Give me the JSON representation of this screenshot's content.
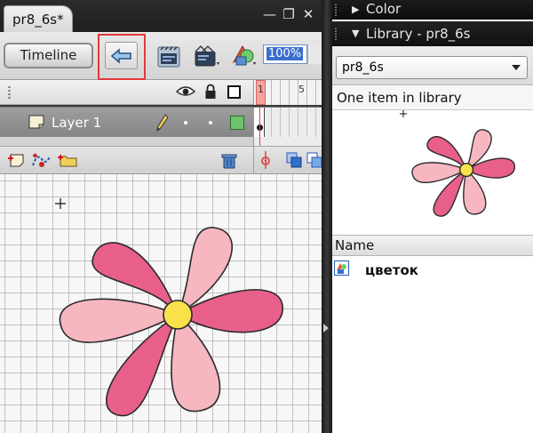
{
  "document": {
    "tab_label": "pr8_6s*",
    "window_buttons": {
      "minimize": "—",
      "restore": "❐",
      "close": "✕"
    }
  },
  "edit_bar": {
    "timeline_label": "Timeline",
    "back_icon": "back-arrow-icon",
    "zoom_value": "100%"
  },
  "timeline": {
    "frame_numbers": [
      "1",
      "5"
    ],
    "header_icons": [
      "eye-icon",
      "lock-icon",
      "outline-icon"
    ],
    "layers": [
      {
        "name": "Layer 1",
        "color": "#6cc46c"
      }
    ],
    "footer_icons": [
      "new-layer-icon",
      "add-motion-guide-icon",
      "new-folder-icon",
      "delete-layer-icon",
      "onion-skin-icon",
      "edit-multiple-frames-icon"
    ]
  },
  "stage": {
    "symbol": "flower",
    "colors": {
      "petal_dark": "#e8608a",
      "petal_light": "#f6b7c0",
      "center": "#f9e14b",
      "outline": "#2a2a2a"
    }
  },
  "panels": {
    "color_title": "Color",
    "library_title": "Library - pr8_6s",
    "library_select_value": "pr8_6s",
    "item_count_text": "One item in library",
    "name_column": "Name",
    "items": [
      {
        "name": "цветок",
        "icon": "graphic-symbol-icon"
      }
    ]
  },
  "accents": {
    "highlight_box": "#e23a3a",
    "selection": "#3b6fcf"
  }
}
